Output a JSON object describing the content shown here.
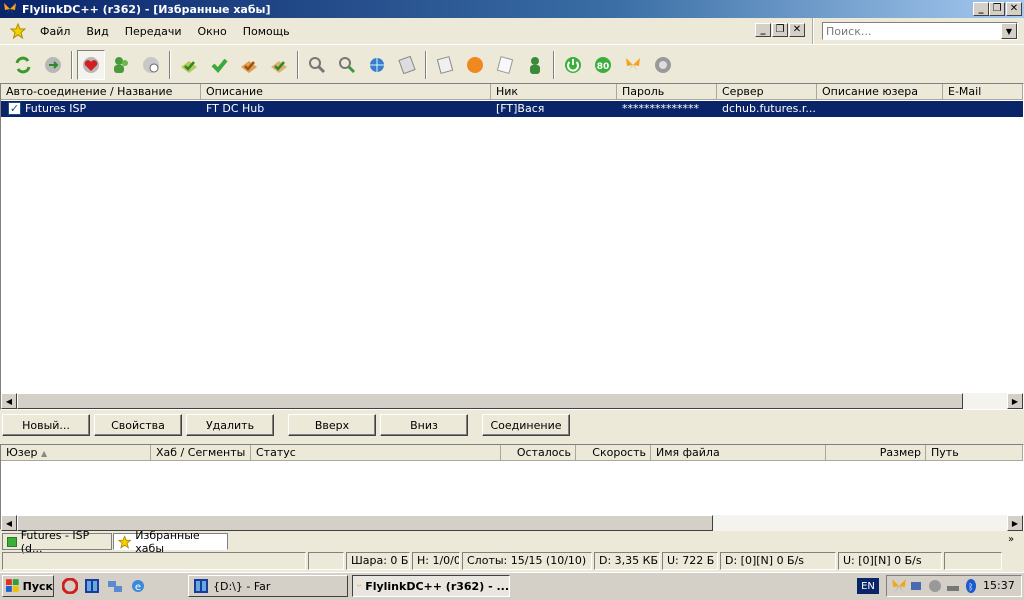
{
  "window": {
    "title": "FlylinkDC++ (r362) - [Избранные хабы]"
  },
  "menu": {
    "items": [
      "Файл",
      "Вид",
      "Передачи",
      "Окно",
      "Помощь"
    ]
  },
  "search": {
    "placeholder": "Поиск..."
  },
  "hub_table": {
    "columns": [
      "Авто-соединение / Название",
      "Описание",
      "Ник",
      "Пароль",
      "Сервер",
      "Описание юзера",
      "E-Mail"
    ],
    "rows": [
      {
        "auto_connect": true,
        "name": "Futures ISP",
        "description": "FT DC Hub",
        "nick": "[FT]Вася",
        "password": "**************",
        "server": "dchub.futures.r...",
        "user_description": "",
        "email": ""
      }
    ]
  },
  "buttons": {
    "new": "Новый...",
    "properties": "Свойства",
    "delete": "Удалить",
    "up": "Вверх",
    "down": "Вниз",
    "connect": "Соединение"
  },
  "transfer_table": {
    "columns": [
      "Юзер",
      "Хаб / Сегменты",
      "Статус",
      "Осталось",
      "Скорость",
      "Имя файла",
      "Размер",
      "Путь"
    ]
  },
  "tabs": [
    {
      "label": "Futures - ISP (d...",
      "active": false
    },
    {
      "label": "Избранные хабы",
      "active": true
    }
  ],
  "status": {
    "share": "Шара: 0 Б",
    "hubs": "H: 1/0/0",
    "slots": "Слоты: 15/15 (10/10)",
    "downloaded": "D: 3,35 КБ",
    "uploaded": "U: 722 Б",
    "down_speed": "D: [0][N] 0 Б/s",
    "up_speed": "U: [0][N] 0 Б/s"
  },
  "taskbar": {
    "start_label": "Пуск",
    "tasks": [
      {
        "label": "{D:\\} - Far",
        "active": false
      },
      {
        "label": "FlylinkDC++ (r362) - ...",
        "active": true
      }
    ],
    "lang": "EN",
    "clock": "15:37"
  },
  "colors": {
    "title_bar": "#0a246a",
    "selection": "#0a246a",
    "face": "#ece9d8"
  }
}
